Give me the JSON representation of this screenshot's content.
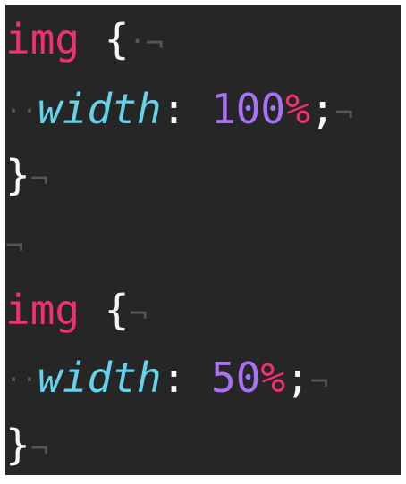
{
  "code": {
    "line1": {
      "selector": "img",
      "space": " ",
      "open": "{",
      "ws_space": "·",
      "eol": "¬"
    },
    "line2": {
      "indent": "··",
      "property": "width",
      "colon": ":",
      "space": " ",
      "value": "100",
      "unit": "%",
      "semicolon": ";",
      "eol": "¬"
    },
    "line3": {
      "close": "}",
      "eol": "¬"
    },
    "line4": {
      "eol": "¬"
    },
    "line5": {
      "selector": "img",
      "space": " ",
      "open": "{",
      "eol": "¬"
    },
    "line6": {
      "indent": "··",
      "property": "width",
      "colon": ":",
      "space": " ",
      "value": "50",
      "unit": "%",
      "semicolon": ";",
      "eol": "¬"
    },
    "line7": {
      "close": "}",
      "eol": "¬"
    }
  },
  "colors": {
    "background": "#262627",
    "selector": "#f0306f",
    "property": "#64d3ea",
    "number": "#a772f4",
    "unit": "#f0306f",
    "text": "#f7f7f2",
    "invisible": "#565656"
  }
}
